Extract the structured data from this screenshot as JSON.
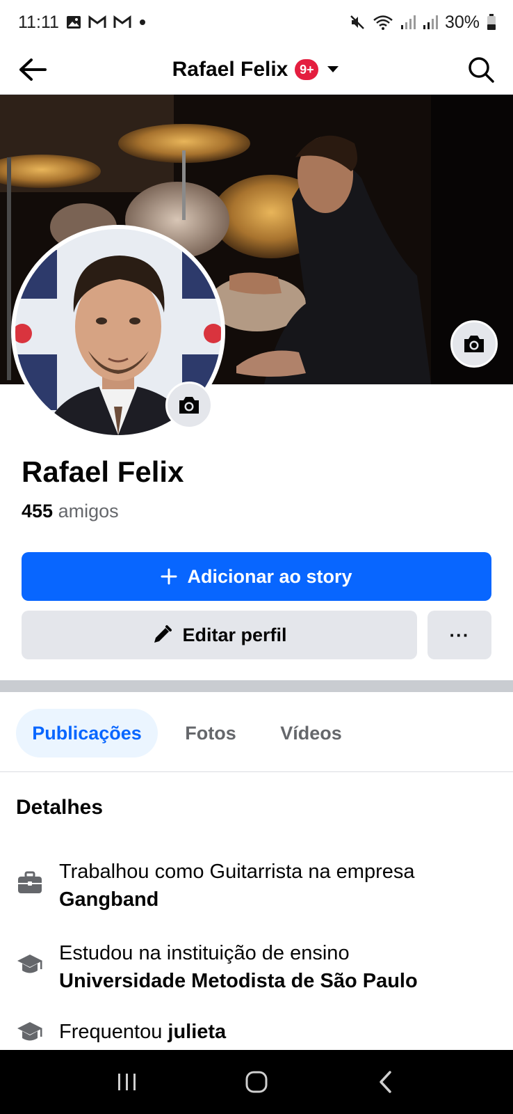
{
  "status_bar": {
    "time": "11:11",
    "battery": "30%",
    "icons": [
      "image-icon",
      "gmail-icon",
      "gmail-icon",
      "dot-icon",
      "mute-icon",
      "wifi-icon",
      "signal-icon",
      "signal-icon",
      "battery-icon"
    ]
  },
  "header": {
    "title": "Rafael Felix",
    "badge": "9+",
    "back_icon": "arrow-left-icon",
    "dropdown_icon": "caret-down-icon",
    "search_icon": "search-icon"
  },
  "profile": {
    "name": "Rafael Felix",
    "friends_count": "455",
    "friends_label": "amigos"
  },
  "actions": {
    "add_story_label": "Adicionar ao story",
    "edit_profile_label": "Editar perfil",
    "more_label": "···"
  },
  "tabs": [
    {
      "label": "Publicações",
      "active": true
    },
    {
      "label": "Fotos",
      "active": false
    },
    {
      "label": "Vídeos",
      "active": false
    }
  ],
  "details": {
    "title": "Detalhes",
    "items": [
      {
        "icon": "briefcase-icon",
        "text": "Trabalhou como Guitarrista na empresa",
        "bold": "Gangband"
      },
      {
        "icon": "graduation-cap-icon",
        "text": "Estudou na instituição de ensino",
        "bold": "Universidade Metodista de São Paulo"
      },
      {
        "icon": "graduation-cap-icon",
        "text": "Frequentou",
        "bold": "julieta"
      }
    ]
  },
  "colors": {
    "primary": "#0866ff",
    "badge": "#e41e3f",
    "secondary_button": "#e4e6eb",
    "active_tab_bg": "#ebf5ff"
  }
}
